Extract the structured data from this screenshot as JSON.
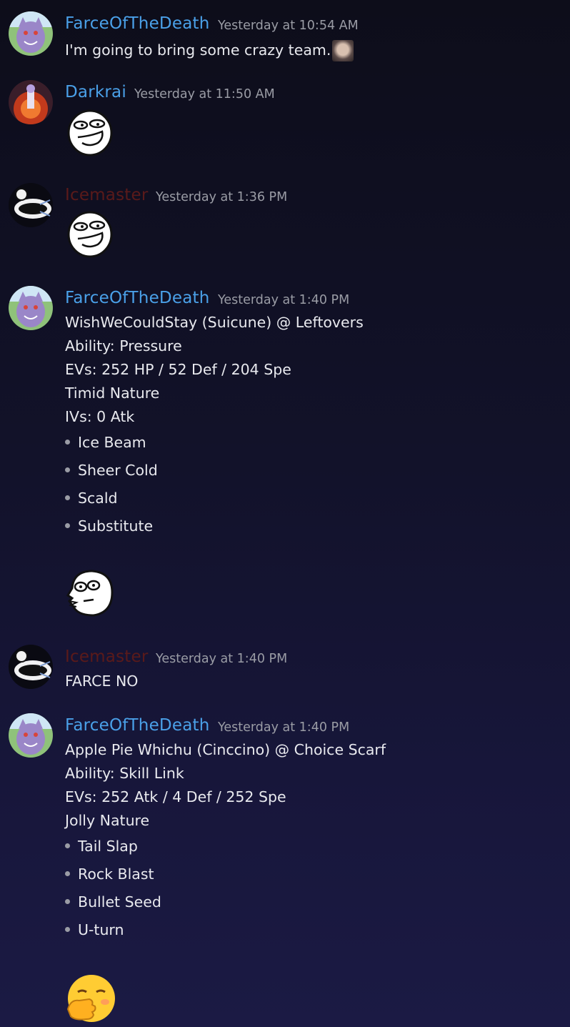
{
  "messages": [
    {
      "author": "FarceOfTheDeath",
      "time": "Yesterday at 10:54 AM",
      "text": "I'm going to bring some crazy team."
    },
    {
      "author": "Darkrai",
      "time": "Yesterday at 11:50 AM"
    },
    {
      "author": "Icemaster",
      "time": "Yesterday at 1:36 PM"
    },
    {
      "author": "FarceOfTheDeath",
      "time": "Yesterday at 1:40 PM",
      "lines": [
        "WishWeCouldStay (Suicune) @ Leftovers",
        "Ability: Pressure",
        "EVs: 252 HP / 52 Def / 204 Spe",
        "Timid Nature",
        "IVs: 0 Atk"
      ],
      "moves": [
        "Ice Beam",
        "Sheer Cold",
        "Scald",
        "Substitute"
      ]
    },
    {
      "author": "Icemaster",
      "time": "Yesterday at 1:40 PM",
      "text": "FARCE NO"
    },
    {
      "author": "FarceOfTheDeath",
      "time": "Yesterday at 1:40 PM",
      "lines": [
        "Apple Pie Whichu (Cinccino) @ Choice Scarf",
        "Ability: Skill Link",
        "EVs: 252 Atk / 4 Def / 252 Spe",
        "Jolly Nature"
      ],
      "moves": [
        "Tail Slap",
        "Rock Blast",
        "Bullet Seed",
        "U-turn"
      ]
    }
  ],
  "colors": {
    "farce": "#4aa0e8",
    "darkrai": "#4aa0e8",
    "icemaster": "#5a1a1a",
    "timestamp": "#9a9ca5"
  }
}
